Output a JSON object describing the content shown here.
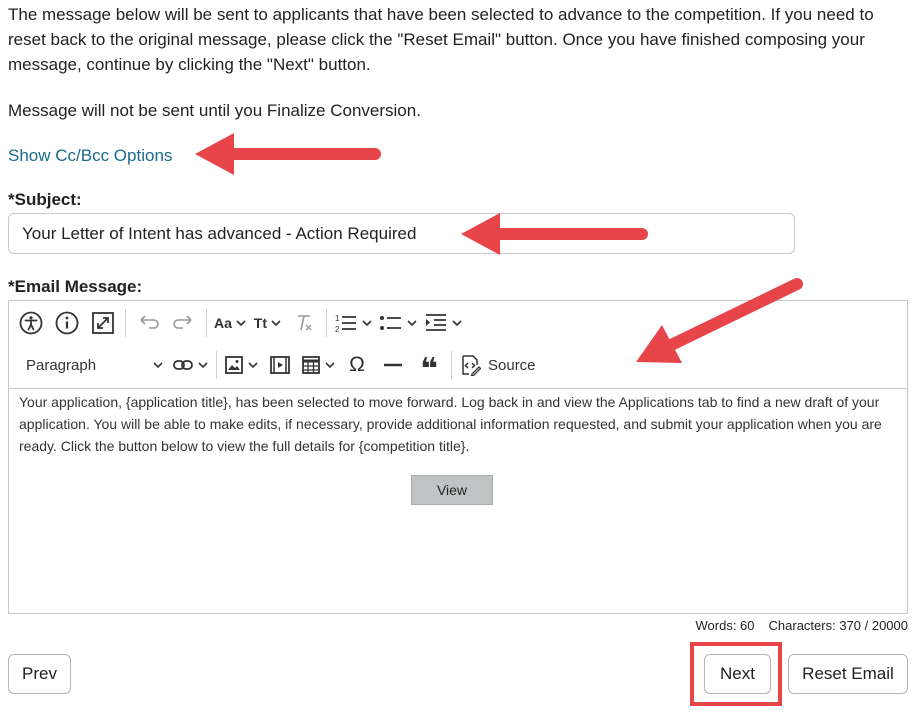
{
  "intro": {
    "text": "The message below will be sent to applicants that have been selected to advance to the competition. If you need to reset back to the original message, please click the \"Reset Email\" button. Once you have finished composing your message, continue by clicking the \"Next\" button.",
    "note": "Message will not be sent until you Finalize Conversion."
  },
  "cc_link": "Show Cc/Bcc Options",
  "subject": {
    "label": "*Subject:",
    "value": "Your Letter of Intent has advanced - Action Required"
  },
  "email": {
    "label": "*Email Message:",
    "paragraph_select": "Paragraph",
    "source_label": "Source",
    "body": "Your application, {application title}, has been selected to move forward. Log back in and view the Applications tab to find a new draft of your application. You will be able to make edits, if necessary, provide additional information requested, and submit your application when you are ready. Click the button below to view the full details for {competition title}.",
    "view_button": "View"
  },
  "counter": {
    "words": "Words: 60",
    "characters": "Characters: 370 / 20000"
  },
  "buttons": {
    "prev": "Prev",
    "next": "Next",
    "reset": "Reset Email"
  },
  "annotation_color": "#e8454a",
  "icons": [
    "accessibility-icon",
    "info-icon",
    "fullscreen-icon",
    "undo-icon",
    "redo-icon",
    "font-family-icon",
    "font-size-icon",
    "remove-format-icon",
    "numbered-list-icon",
    "bulleted-list-icon",
    "indent-icon",
    "link-icon",
    "image-icon",
    "media-icon",
    "table-icon",
    "special-character-icon",
    "horizontal-line-icon",
    "blockquote-icon",
    "source-icon"
  ]
}
